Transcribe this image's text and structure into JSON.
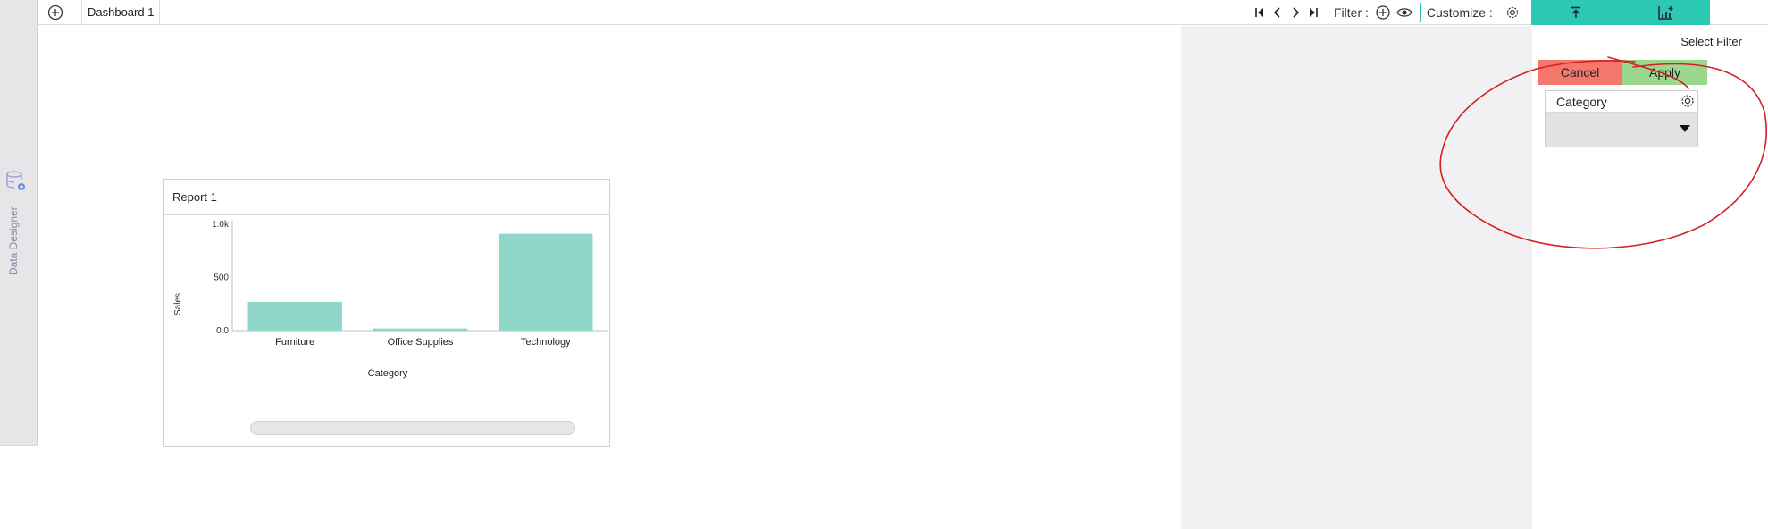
{
  "left_rail": {
    "label": "Data Designer"
  },
  "top_bar": {
    "tab_label": "Dashboard 1",
    "filter_label": "Filter :",
    "customize_label": "Customize :",
    "icons": [
      "add-circle-icon",
      "first-page-icon",
      "prev-page-icon",
      "next-page-icon",
      "last-page-icon",
      "add-filter-icon",
      "eye-icon",
      "gear-icon",
      "upload-icon",
      "add-chart-icon"
    ]
  },
  "report": {
    "title": "Report 1",
    "scrollbar_position": 0
  },
  "chart_data": {
    "type": "bar",
    "categories": [
      "Furniture",
      "Office Supplies",
      "Technology"
    ],
    "values": [
      270,
      20,
      910
    ],
    "xlabel": "Category",
    "ylabel": "Sales",
    "yticks": [
      "0.0",
      "500",
      "1.0k"
    ],
    "ylim": [
      0,
      1000
    ],
    "colors": {
      "bar": "#8fd5c8"
    }
  },
  "filter_panel": {
    "title": "Select Filter",
    "cancel_label": "Cancel",
    "apply_label": "Apply",
    "card_label": "Category",
    "selected_value": ""
  },
  "colors": {
    "accent": "#2bc9b4",
    "cancel": "#f5776c",
    "apply": "#9bd88e",
    "annotation": "#d42020"
  }
}
